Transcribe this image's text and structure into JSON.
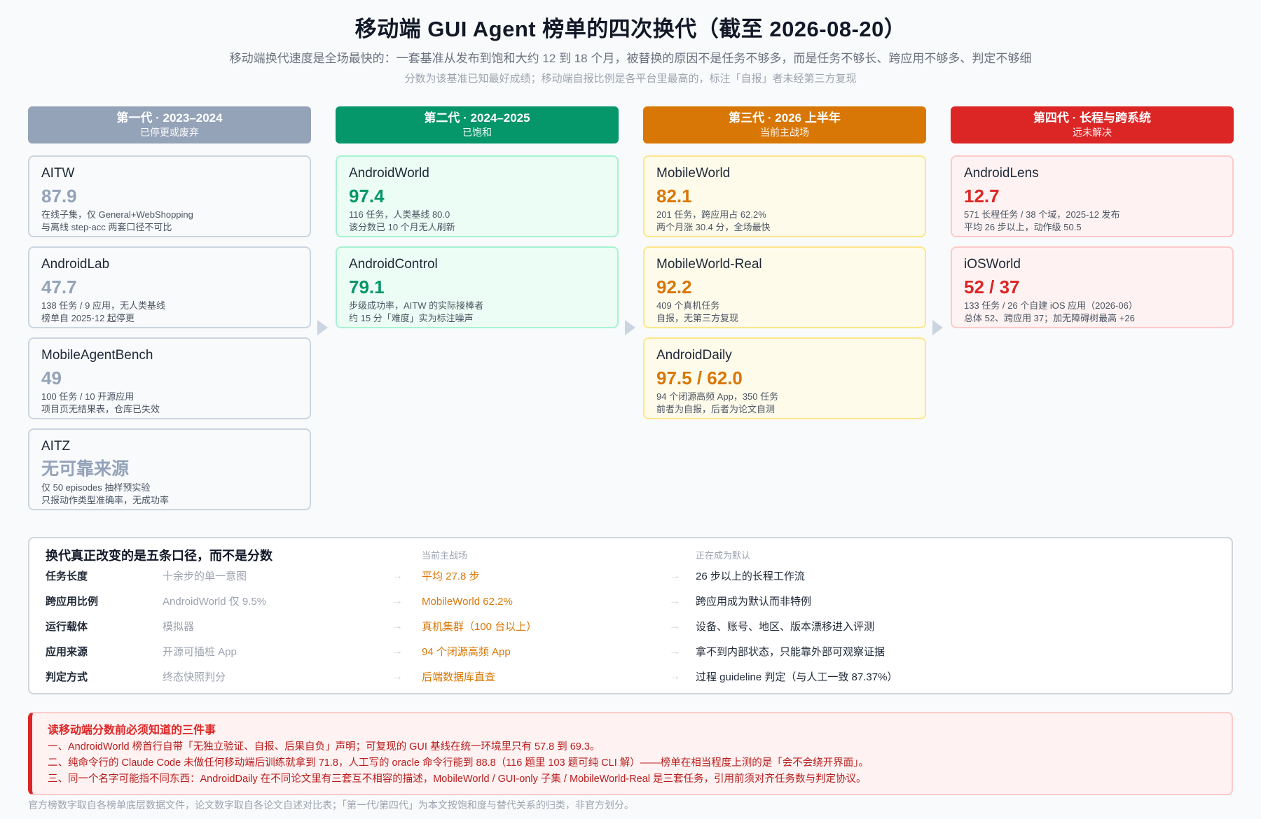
{
  "header": {
    "title": "移动端 GUI Agent 榜单的四次换代（截至 2026-08-20）",
    "subtitle": "移动端换代速度是全场最快的：一套基准从发布到饱和大约 12 到 18 个月，被替换的原因不是任务不够多，而是任务不够长、跨应用不够多、判定不够细",
    "note": "分数为该基准已知最好成绩；移动端自报比例是各平台里最高的，标注「自报」者未经第三方复现"
  },
  "generations": [
    {
      "name": "第一代 · 2023–2024",
      "status": "已停更或废弃",
      "color": "#94a3b8",
      "cards": [
        {
          "name": "AITW",
          "score": "87.9",
          "line1": "在线子集，仅 General+WebShopping",
          "line2": "与离线 step-acc 两套口径不可比"
        },
        {
          "name": "AndroidLab",
          "score": "47.7",
          "line1": "138 任务 / 9 应用，无人类基线",
          "line2": "榜单自 2025-12 起停更"
        },
        {
          "name": "MobileAgentBench",
          "score": "49",
          "line1": "100 任务 / 10 开源应用",
          "line2": "项目页无结果表，仓库已失效"
        },
        {
          "name": "AITZ",
          "score": "无可靠来源",
          "line1": "仅 50 episodes 抽样预实验",
          "line2": "只报动作类型准确率，无成功率"
        }
      ]
    },
    {
      "name": "第二代 · 2024–2025",
      "status": "已饱和",
      "color": "#059669",
      "cards": [
        {
          "name": "AndroidWorld",
          "score": "97.4",
          "line1": "116 任务，人类基线 80.0",
          "line2": "该分数已 10 个月无人刷新"
        },
        {
          "name": "AndroidControl",
          "score": "79.1",
          "line1": "步级成功率，AITW 的实际接棒者",
          "line2": "约 15 分「难度」实为标注噪声"
        }
      ]
    },
    {
      "name": "第三代 · 2026 上半年",
      "status": "当前主战场",
      "color": "#d97706",
      "cards": [
        {
          "name": "MobileWorld",
          "score": "82.1",
          "line1": "201 任务，跨应用占 62.2%",
          "line2": "两个月涨 30.4 分，全场最快"
        },
        {
          "name": "MobileWorld-Real",
          "score": "92.2",
          "line1": "409 个真机任务",
          "line2": "自报，无第三方复现"
        },
        {
          "name": "AndroidDaily",
          "score": "97.5 / 62.0",
          "line1": "94 个闭源高频 App，350 任务",
          "line2": "前者为自报，后者为论文自测"
        }
      ]
    },
    {
      "name": "第四代 · 长程与跨系统",
      "status": "远未解决",
      "color": "#dc2626",
      "cards": [
        {
          "name": "AndroidLens",
          "score": "12.7",
          "line1": "571 长程任务 / 38 个域，2025-12 发布",
          "line2": "平均 26 步以上，动作级 50.5"
        },
        {
          "name": "iOSWorld",
          "score": "52 / 37",
          "line1": "133 任务 / 26 个自建 iOS 应用（2026-06）",
          "line2": "总体 52、跨应用 37；加无障碍树最高 +26"
        }
      ]
    }
  ],
  "shifts": {
    "title": "换代真正改变的是五条口径，而不是分数",
    "col_current": "当前主战场",
    "col_default": "正在成为默认",
    "arrow": "→",
    "rows": [
      {
        "label": "任务长度",
        "old": "十余步的单一意图",
        "current": "平均 27.8 步",
        "next": "26 步以上的长程工作流"
      },
      {
        "label": "跨应用比例",
        "old": "AndroidWorld 仅 9.5%",
        "current": "MobileWorld 62.2%",
        "next": "跨应用成为默认而非特例"
      },
      {
        "label": "运行载体",
        "old": "模拟器",
        "current": "真机集群（100 台以上）",
        "next": "设备、账号、地区、版本漂移进入评测"
      },
      {
        "label": "应用来源",
        "old": "开源可插桩 App",
        "current": "94 个闭源高频 App",
        "next": "拿不到内部状态，只能靠外部可观察证据"
      },
      {
        "label": "判定方式",
        "old": "终态快照判分",
        "current": "后端数据库直查",
        "next": "过程 guideline 判定（与人工一致 87.37%）"
      }
    ]
  },
  "warnings": {
    "title": "读移动端分数前必须知道的三件事",
    "items": [
      "一、AndroidWorld 榜首行自带「无独立验证、自报、后果自负」声明；可复现的 GUI 基线在统一环境里只有 57.8 到 69.3。",
      "二、纯命令行的 Claude Code 未做任何移动端后训练就拿到 71.8，人工写的 oracle 命令行能到 88.8（116 题里 103 题可纯 CLI 解）——榜单在相当程度上测的是「会不会绕开界面」。",
      "三、同一个名字可能指不同东西：AndroidDaily 在不同论文里有三套互不相容的描述，MobileWorld / GUI-only 子集 / MobileWorld-Real 是三套任务，引用前须对齐任务数与判定协议。"
    ]
  },
  "footer": "官方榜数字取自各榜单底层数据文件，论文数字取自各论文自述对比表；「第一代/第四代」为本文按饱和度与替代关系的归类，非官方划分。"
}
